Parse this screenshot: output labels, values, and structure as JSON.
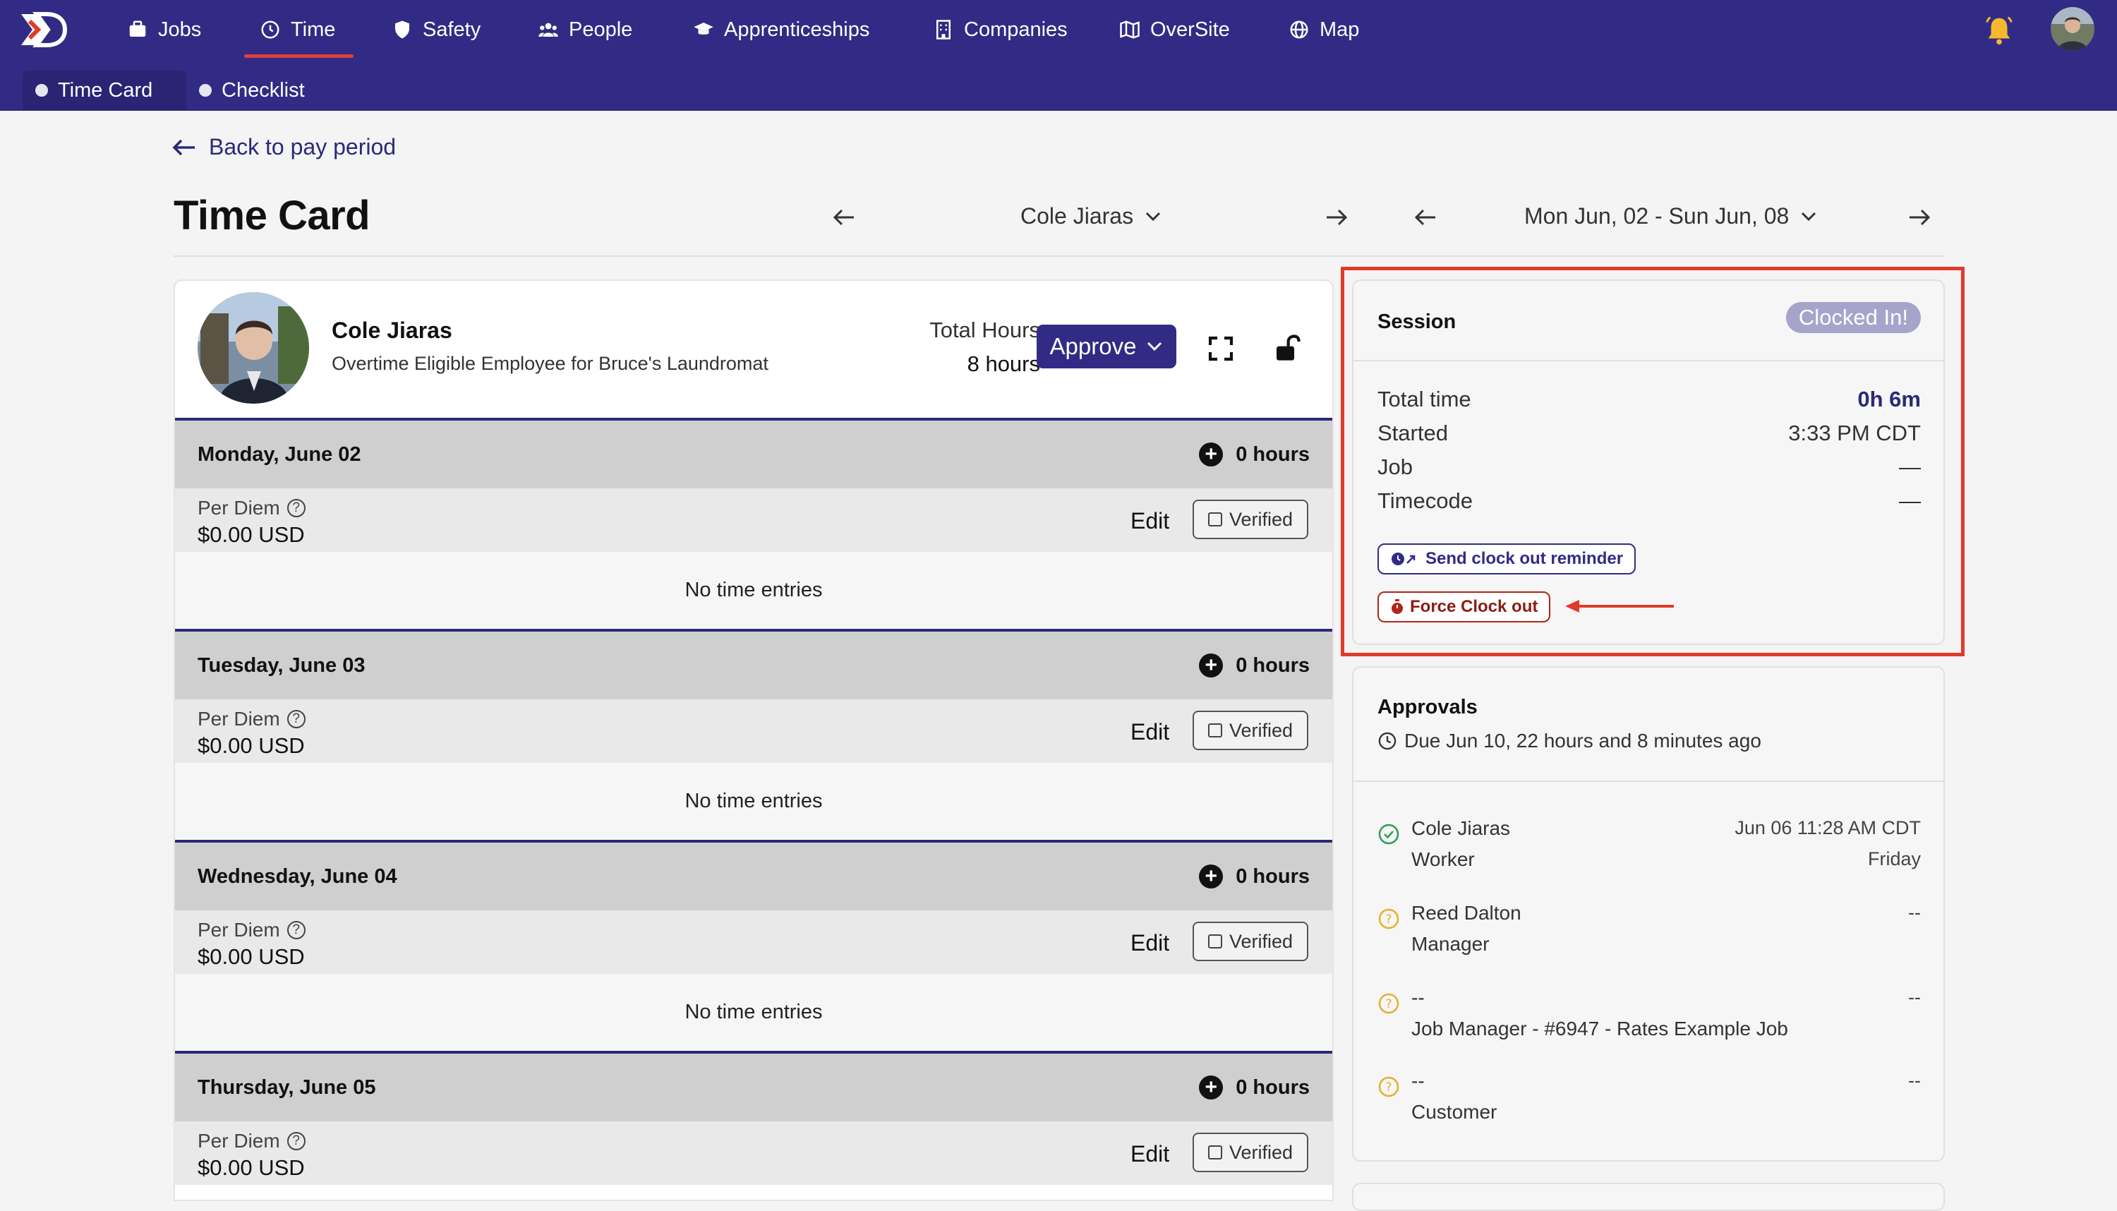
{
  "nav": {
    "items": [
      {
        "label": "Jobs",
        "icon": "briefcase-icon"
      },
      {
        "label": "Time",
        "icon": "clock-icon"
      },
      {
        "label": "Safety",
        "icon": "shield-icon"
      },
      {
        "label": "People",
        "icon": "people-icon"
      },
      {
        "label": "Apprenticeships",
        "icon": "graduation-cap-icon"
      },
      {
        "label": "Companies",
        "icon": "building-icon"
      },
      {
        "label": "OverSite",
        "icon": "map-fold-icon"
      },
      {
        "label": "Map",
        "icon": "globe-icon"
      }
    ],
    "active": "Time"
  },
  "subtabs": {
    "time_card": "Time Card",
    "checklist": "Checklist"
  },
  "page": {
    "back_label": "Back to pay period",
    "title": "Time Card",
    "employee_select": "Cole Jiaras",
    "date_range": "Mon Jun, 02 - Sun Jun, 08"
  },
  "employee": {
    "name": "Cole Jiaras",
    "subtitle": "Overtime Eligible Employee for Bruce's Laundromat",
    "total_label": "Total Hours",
    "total_value": "8 hours",
    "approve_label": "Approve"
  },
  "days": [
    {
      "name": "Monday, June 02",
      "hours": "0 hours",
      "per_diem_label": "Per Diem",
      "per_diem": "$0.00 USD",
      "edit": "Edit",
      "verified": "Verified",
      "entries": "No time entries"
    },
    {
      "name": "Tuesday, June 03",
      "hours": "0 hours",
      "per_diem_label": "Per Diem",
      "per_diem": "$0.00 USD",
      "edit": "Edit",
      "verified": "Verified",
      "entries": "No time entries"
    },
    {
      "name": "Wednesday, June 04",
      "hours": "0 hours",
      "per_diem_label": "Per Diem",
      "per_diem": "$0.00 USD",
      "edit": "Edit",
      "verified": "Verified",
      "entries": "No time entries"
    },
    {
      "name": "Thursday, June 05",
      "hours": "0 hours",
      "per_diem_label": "Per Diem",
      "per_diem": "$0.00 USD",
      "edit": "Edit",
      "verified": "Verified"
    }
  ],
  "session": {
    "title": "Session",
    "badge": "Clocked In!",
    "rows": [
      {
        "label": "Total time",
        "value": "0h 6m"
      },
      {
        "label": "Started",
        "value": "3:33 PM CDT"
      },
      {
        "label": "Job",
        "value": "—"
      },
      {
        "label": "Timecode",
        "value": "—"
      }
    ],
    "reminder_label": "Send clock out reminder",
    "force_label": "Force Clock out"
  },
  "approvals": {
    "title": "Approvals",
    "due": "Due Jun 10, 22 hours and 8 minutes ago",
    "rows": [
      {
        "name": "Cole Jiaras",
        "role": "Worker",
        "date": "Jun 06 11:28 AM CDT",
        "day": "Friday",
        "status": "approved"
      },
      {
        "name": "Reed Dalton",
        "role": "Manager",
        "date": "--",
        "status": "pending"
      },
      {
        "name": "--",
        "role": "Job Manager - #6947 - Rates Example Job",
        "date": "--",
        "status": "pending"
      },
      {
        "name": "--",
        "role": "Customer",
        "date": "--",
        "status": "pending"
      }
    ]
  },
  "colors": {
    "brand": "#322b85",
    "alert": "#e23a2a",
    "approved": "#2e9e58",
    "pending": "#e3b12c"
  }
}
